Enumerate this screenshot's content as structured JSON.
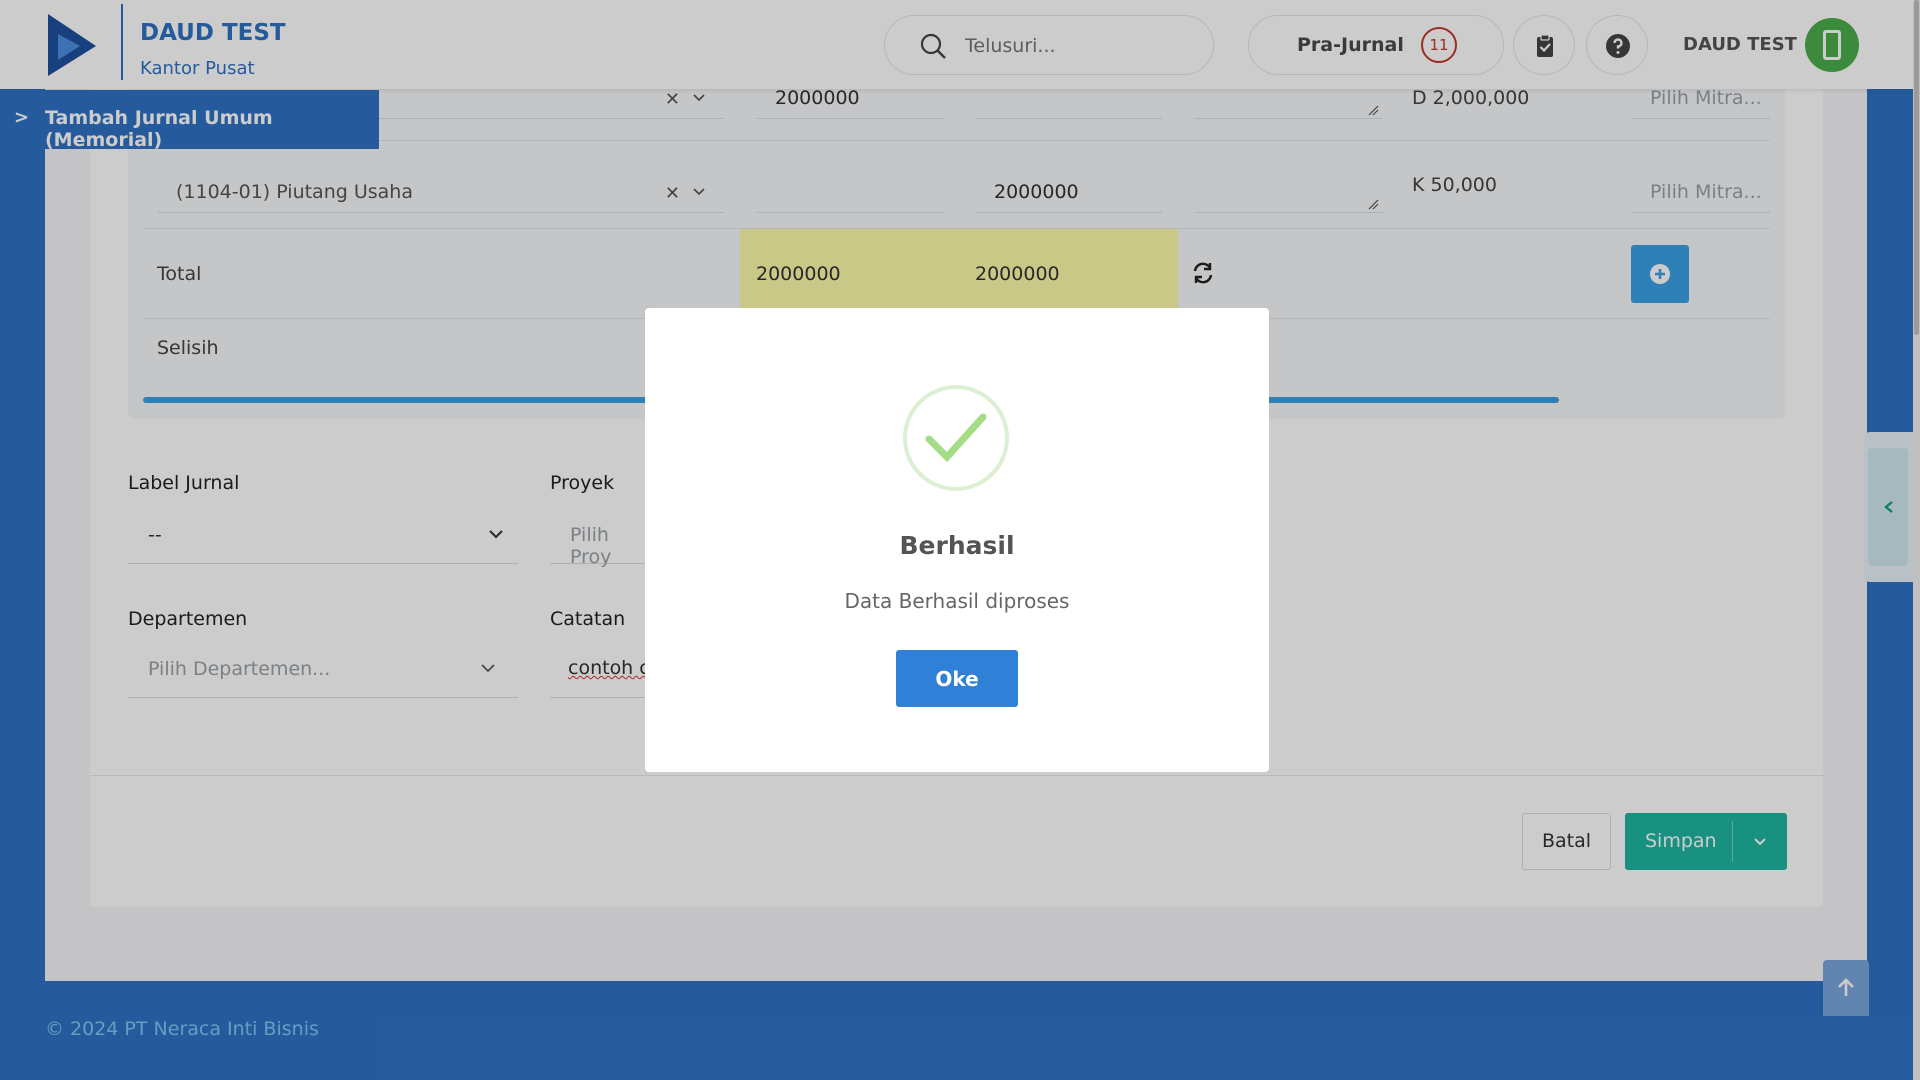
{
  "header": {
    "company": "DAUD TEST",
    "branch": "Kantor Pusat",
    "search_placeholder": "Telusuri...",
    "prajurnal_label": "Pra-Jurnal",
    "prajurnal_count": "11",
    "user_name": "DAUD TEST"
  },
  "breadcrumb": {
    "title": "Tambah Jurnal Umum (Memorial)",
    "toggle": ">"
  },
  "journal": {
    "rows": [
      {
        "account": "",
        "debit": "2000000",
        "credit": "",
        "summary": "D 2,000,000",
        "partner_placeholder": "Pilih Mitra..."
      },
      {
        "account": "(1104-01) Piutang Usaha",
        "debit": "",
        "credit": "2000000",
        "summary": "K 50,000",
        "partner_placeholder": "Pilih Mitra..."
      }
    ],
    "total_label": "Total",
    "total_debit": "2000000",
    "total_credit": "2000000",
    "diff_label": "Selisih"
  },
  "form": {
    "label_jurnal": "Label Jurnal",
    "label_jurnal_value": "--",
    "proyek": "Proyek",
    "proyek_placeholder": "Pilih Proy",
    "departemen": "Departemen",
    "departemen_placeholder": "Pilih Departemen...",
    "catatan": "Catatan",
    "catatan_value": "contoh c"
  },
  "actions": {
    "batal": "Batal",
    "simpan": "Simpan"
  },
  "footer": {
    "copyright": "© 2024 PT Neraca Inti Bisnis"
  },
  "modal": {
    "title": "Berhasil",
    "message": "Data Berhasil diproses",
    "ok_label": "Oke"
  },
  "colors": {
    "primary": "#2f72c4",
    "success": "#1fb6a0",
    "highlight": "#fcfaa8",
    "modal_button": "#2f80d6"
  }
}
